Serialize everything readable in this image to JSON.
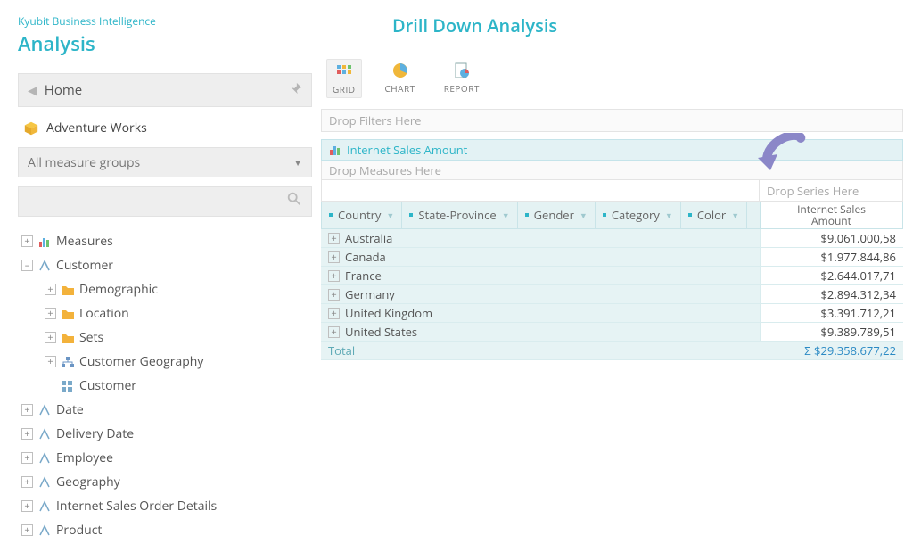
{
  "brand": {
    "small": "Kyubit Business Intelligence",
    "large": "Analysis"
  },
  "title": "Drill Down Analysis",
  "home_label": "Home",
  "cube_label": "Adventure Works",
  "measure_group_select": "All measure groups",
  "search_placeholder": "",
  "viewmodes": {
    "grid": "GRID",
    "chart": "CHART",
    "report": "REPORT"
  },
  "drops": {
    "filters": "Drop Filters Here",
    "measures": "Drop Measures Here",
    "series": "Drop Series Here"
  },
  "active_measure": "Internet Sales Amount",
  "dim_headers": [
    "Country",
    "State-Province",
    "Gender",
    "Category",
    "Color"
  ],
  "metric_header_line1": "Internet Sales",
  "metric_header_line2": "Amount",
  "rows": [
    {
      "label": "Australia",
      "value": "$9.061.000,58"
    },
    {
      "label": "Canada",
      "value": "$1.977.844,86"
    },
    {
      "label": "France",
      "value": "$2.644.017,71"
    },
    {
      "label": "Germany",
      "value": "$2.894.312,34"
    },
    {
      "label": "United Kingdom",
      "value": "$3.391.712,21"
    },
    {
      "label": "United States",
      "value": "$9.389.789,51"
    }
  ],
  "total": {
    "label": "Total",
    "value": "Σ $29.358.677,22"
  },
  "tree": {
    "measures": "Measures",
    "customer": "Customer",
    "demographic": "Demographic",
    "location": "Location",
    "sets": "Sets",
    "cust_geo": "Customer Geography",
    "cust_leaf": "Customer",
    "date": "Date",
    "delivery_date": "Delivery Date",
    "employee": "Employee",
    "geography": "Geography",
    "isod": "Internet Sales Order Details",
    "product": "Product"
  }
}
